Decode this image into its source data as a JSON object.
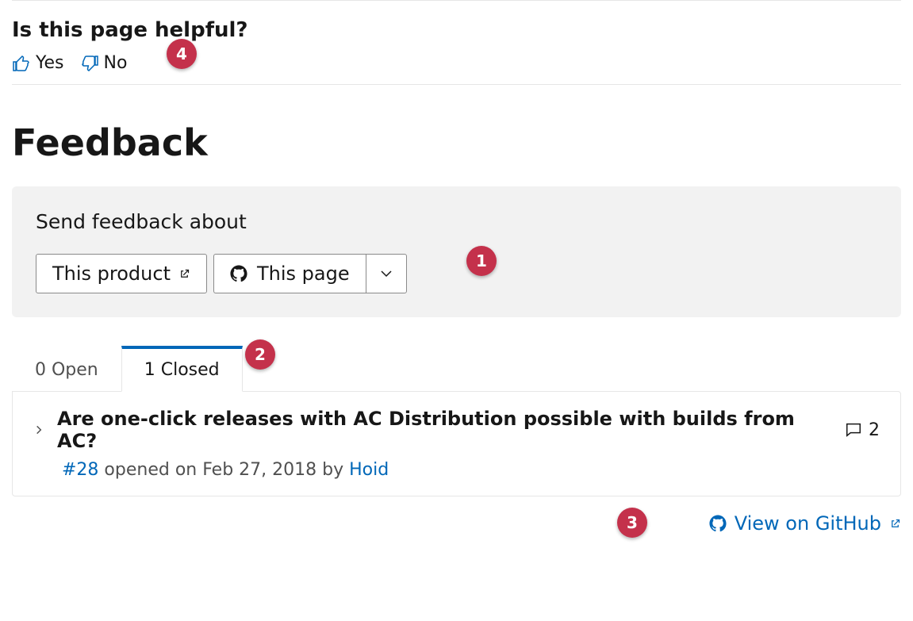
{
  "helpful": {
    "heading": "Is this page helpful?",
    "yes": "Yes",
    "no": "No"
  },
  "feedback": {
    "heading": "Feedback",
    "subheading": "Send feedback about",
    "product_button": "This product",
    "page_button": "This page"
  },
  "tabs": {
    "open_label": "0 Open",
    "closed_label": "1 Closed",
    "open_count": 0,
    "closed_count": 1
  },
  "issue": {
    "title": "Are one-click releases with AC Distribution possible with builds from AC?",
    "number": "#28",
    "meta_mid": " opened on Feb 27, 2018 by ",
    "author": "Hoid",
    "comments": "2"
  },
  "footer": {
    "github": "View on GitHub"
  },
  "callouts": {
    "c1": "1",
    "c2": "2",
    "c3": "3",
    "c4": "4"
  }
}
